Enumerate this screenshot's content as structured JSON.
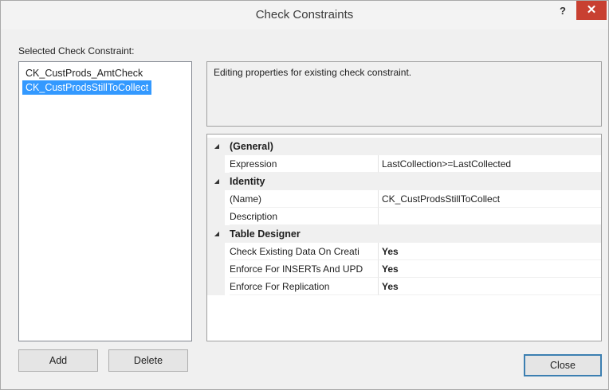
{
  "window": {
    "title": "Check Constraints",
    "help_glyph": "?",
    "close_glyph": "✕"
  },
  "list": {
    "label": "Selected Check Constraint:",
    "items": [
      {
        "label": "CK_CustProds_AmtCheck",
        "selected": false
      },
      {
        "label": "CK_CustProdsStillToCollect",
        "selected": true
      }
    ]
  },
  "description": "Editing properties for existing check constraint.",
  "properties": {
    "groups": [
      {
        "category": "(General)",
        "rows": [
          {
            "name": "Expression",
            "value": "LastCollection>=LastCollected"
          }
        ]
      },
      {
        "category": "Identity",
        "rows": [
          {
            "name": "(Name)",
            "value": "CK_CustProdsStillToCollect"
          },
          {
            "name": "Description",
            "value": ""
          }
        ]
      },
      {
        "category": "Table Designer",
        "rows": [
          {
            "name": "Check Existing Data On Creati",
            "value": "Yes"
          },
          {
            "name": "Enforce For INSERTs And UPD",
            "value": "Yes"
          },
          {
            "name": "Enforce For Replication",
            "value": "Yes"
          }
        ]
      }
    ],
    "expand_glyph": "◢"
  },
  "buttons": {
    "add": "Add",
    "delete": "Delete",
    "close": "Close"
  },
  "colors": {
    "selection": "#3399ff",
    "close_button": "#c84031"
  }
}
